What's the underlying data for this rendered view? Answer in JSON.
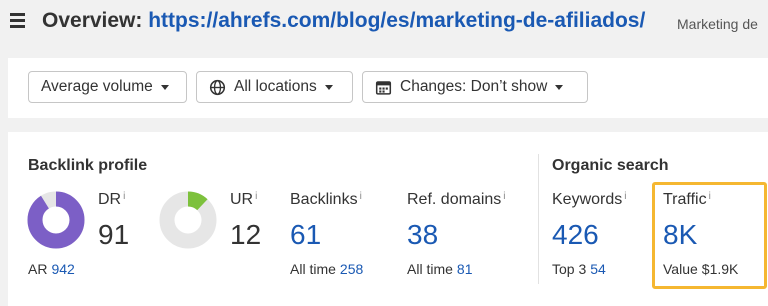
{
  "header": {
    "title_prefix": "Overview:",
    "url": "https://ahrefs.com/blog/es/marketing-de-afiliados/",
    "subtitle": "Marketing de"
  },
  "filters": {
    "volume": "Average volume",
    "locations": "All locations",
    "changes": "Changes: Don’t show"
  },
  "backlink_profile": {
    "title": "Backlink profile",
    "dr": {
      "label": "DR",
      "value": "91",
      "fill_fraction": 0.91
    },
    "ar": {
      "label": "AR",
      "value": "942"
    },
    "ur": {
      "label": "UR",
      "value": "12",
      "fill_fraction": 0.12
    },
    "backlinks": {
      "label": "Backlinks",
      "value": "61",
      "sub_label": "All time",
      "sub_value": "258"
    },
    "ref_domains": {
      "label": "Ref. domains",
      "value": "38",
      "sub_label": "All time",
      "sub_value": "81"
    }
  },
  "organic_search": {
    "title": "Organic search",
    "keywords": {
      "label": "Keywords",
      "value": "426",
      "sub_label": "Top 3",
      "sub_value": "54"
    },
    "traffic": {
      "label": "Traffic",
      "value": "8K",
      "sub_label": "Value",
      "sub_value": "$1.9K"
    }
  },
  "info_glyph": "i",
  "colors": {
    "link": "#1a59b3",
    "dr_fill": "#7c5fc6",
    "ur_fill": "#7dc13c",
    "donut_track": "#e6e6e6",
    "highlight": "#f5b731"
  }
}
